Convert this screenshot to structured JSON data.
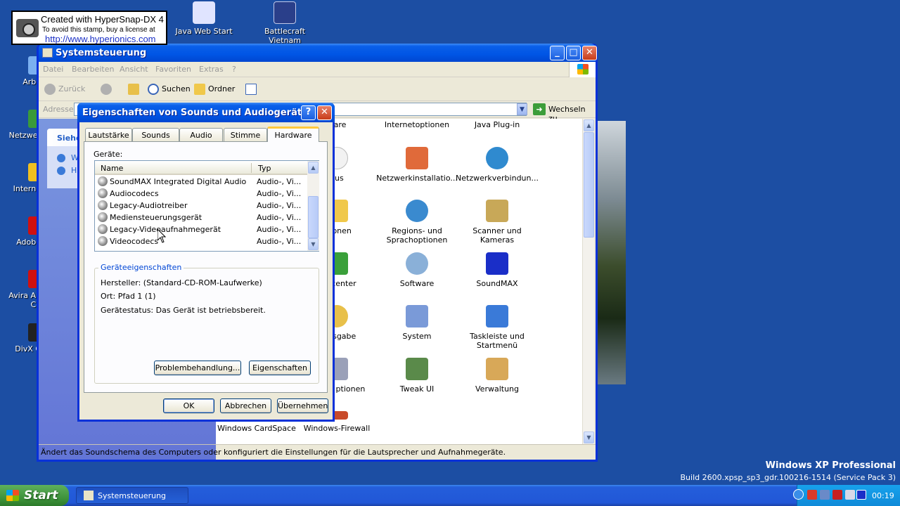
{
  "stamp": {
    "line1": "Created with HyperSnap-DX 4",
    "line2": "To avoid this stamp, buy a license at",
    "line3": "http://www.hyperionics.com"
  },
  "desktop": {
    "top_icons": [
      {
        "label": "Java Web Start",
        "icon": "java-icon",
        "color": "#e0e4ff"
      },
      {
        "label": "Battlecraft Vietnam",
        "icon": "battlecraft-icon",
        "color": "#2a3f8a"
      }
    ],
    "left_icons": [
      {
        "label": "Arbe",
        "icon": "my-computer-icon",
        "color": "#7bb0f0"
      },
      {
        "label": "Netzwer",
        "icon": "network-icon",
        "color": "#3a9a3a"
      },
      {
        "label": "Interne",
        "icon": "internet-explorer-icon",
        "color": "#f0c020"
      },
      {
        "label": "Adobe",
        "icon": "adobe-icon",
        "color": "#d01010"
      },
      {
        "label": "Avira An",
        "label2": "Ce",
        "icon": "avira-icon",
        "color": "#d01010"
      },
      {
        "label": "DivX C",
        "icon": "divx-icon",
        "color": "#222222"
      }
    ]
  },
  "explorer": {
    "title": "Systemsteuerung",
    "menu": [
      "Datei",
      "Bearbeiten",
      "Ansicht",
      "Favoriten",
      "Extras",
      "?"
    ],
    "toolbar": {
      "back": "Zurück",
      "search": "Suchen",
      "folders": "Ordner"
    },
    "address": {
      "label": "Adresse",
      "go": "Wechseln zu"
    },
    "taskpane_header": "Siehe",
    "taskpane_links": [
      "W",
      "H"
    ],
    "items": [
      {
        "label": "ware",
        "icon": "partial-icon"
      },
      {
        "label": "Internetoptionen",
        "icon": "internet-options-icon"
      },
      {
        "label": "Java Plug-in",
        "icon": "java-icon"
      },
      {
        "label": "aus",
        "icon": "mouse-icon"
      },
      {
        "label": "Netzwerkinstallatio...",
        "icon": "network-setup-icon"
      },
      {
        "label": "Netzwerkverbindun...",
        "icon": "network-connections-icon"
      },
      {
        "label": "ptionen",
        "icon": "folder-options-icon"
      },
      {
        "label": "Regions- und Sprachoptionen",
        "icon": "regional-options-icon"
      },
      {
        "label": "Scanner und Kameras",
        "icon": "scanner-camera-icon"
      },
      {
        "label": "eitscenter",
        "icon": "security-center-icon"
      },
      {
        "label": "Software",
        "icon": "software-icon"
      },
      {
        "label": "SoundMAX",
        "icon": "soundmax-icon"
      },
      {
        "label": "-/ausgabe",
        "icon": "speech-icon"
      },
      {
        "label": "System",
        "icon": "system-icon"
      },
      {
        "label": "Taskleiste und Startmenü",
        "icon": "taskbar-startmenu-icon"
      },
      {
        "label": "n- und ptionen",
        "icon": "phone-modem-icon"
      },
      {
        "label": "Tweak UI",
        "icon": "tweakui-icon"
      },
      {
        "label": "Verwaltung",
        "icon": "administration-icon"
      },
      {
        "label": "Windows CardSpace",
        "icon": "cardspace-icon"
      },
      {
        "label": "Windows-Firewall",
        "icon": "firewall-icon"
      }
    ],
    "status": "Ändert das Soundschema des Computers oder konfiguriert die Einstellungen für die Lautsprecher und Aufnahmegeräte."
  },
  "dialog": {
    "title": "Eigenschaften von Sounds und Audiogeräte",
    "tabs": [
      "Lautstärke",
      "Sounds",
      "Audio",
      "Stimme",
      "Hardware"
    ],
    "active_tab": "Hardware",
    "devices_label": "Geräte:",
    "columns": {
      "name": "Name",
      "type": "Typ"
    },
    "devices": [
      {
        "name": "SoundMAX Integrated Digital Audio",
        "type": "Audio-, Vi..."
      },
      {
        "name": "Audiocodecs",
        "type": "Audio-, Vi..."
      },
      {
        "name": "Legacy-Audiotreiber",
        "type": "Audio-, Vi..."
      },
      {
        "name": "Mediensteuerungsgerät",
        "type": "Audio-, Vi..."
      },
      {
        "name": "Legacy-Videoaufnahmegerät",
        "type": "Audio-, Vi..."
      },
      {
        "name": "Videocodecs",
        "type": "Audio-, Vi..."
      }
    ],
    "group_title": "Geräteeigenschaften",
    "manufacturer": "Hersteller: (Standard-CD-ROM-Laufwerke)",
    "location": "Ort: Pfad 1 (1)",
    "status": "Gerätestatus: Das Gerät ist betriebsbereit.",
    "btn_troubleshoot": "Problembehandlung...",
    "btn_properties": "Eigenschaften",
    "btn_ok": "OK",
    "btn_cancel": "Abbrechen",
    "btn_apply": "Übernehmen"
  },
  "watermark": {
    "line1": "Windows XP Professional",
    "line2": "Build 2600.xpsp_sp3_gdr.100216-1514 (Service Pack 3)"
  },
  "taskbar": {
    "start": "Start",
    "task": "Systemsteuerung",
    "clock": "00:19"
  }
}
